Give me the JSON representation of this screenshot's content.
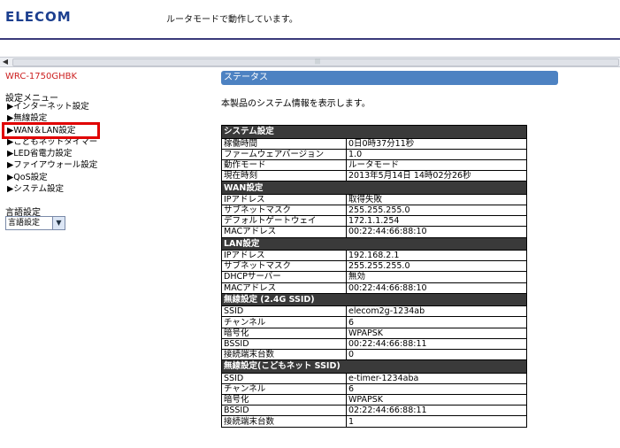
{
  "header": {
    "logo": "ELECOM",
    "mode_text": "ルータモードで動作しています。"
  },
  "sidebar": {
    "model": "WRC-1750GHBK",
    "menu_title": "設定メニュー",
    "items": [
      {
        "label": "▶インターネット設定"
      },
      {
        "label": "▶無線設定"
      },
      {
        "label": "▶WAN＆LAN設定"
      },
      {
        "label": "▶こどもネットタイマー"
      },
      {
        "label": "▶LED省電力設定"
      },
      {
        "label": "▶ファイアウォール設定"
      },
      {
        "label": "▶QoS設定"
      },
      {
        "label": "▶システム設定"
      }
    ],
    "active_index": 2,
    "lang_title": "言語設定",
    "lang_select": "言語設定"
  },
  "main": {
    "status_title": "ステータス",
    "description": "本製品のシステム情報を表示します。",
    "sections": [
      {
        "title": "システム設定",
        "rows": [
          [
            "稼働時間",
            "0日0時37分11秒"
          ],
          [
            "ファームウェアバージョン",
            "1.0"
          ],
          [
            "動作モード",
            "ルータモード"
          ],
          [
            "現在時刻",
            "2013年5月14日 14時02分26秒"
          ]
        ]
      },
      {
        "title": "WAN設定",
        "rows": [
          [
            "IPアドレス",
            "取得失敗"
          ],
          [
            "サブネットマスク",
            "255.255.255.0"
          ],
          [
            "デフォルトゲートウェイ",
            "172.1.1.254"
          ],
          [
            "MACアドレス",
            "00:22:44:66:88:10"
          ]
        ]
      },
      {
        "title": "LAN設定",
        "rows": [
          [
            "IPアドレス",
            "192.168.2.1"
          ],
          [
            "サブネットマスク",
            "255.255.255.0"
          ],
          [
            "DHCPサーバー",
            "無効"
          ],
          [
            "MACアドレス",
            "00:22:44:66:88:10"
          ]
        ]
      },
      {
        "title": "無線設定 (2.4G SSID)",
        "rows": [
          [
            "SSID",
            "elecom2g-1234ab"
          ],
          [
            "チャンネル",
            "6"
          ],
          [
            "暗号化",
            "WPAPSK"
          ],
          [
            "BSSID",
            "00:22:44:66:88:11"
          ],
          [
            "接続端末台数",
            "0"
          ]
        ]
      },
      {
        "title": "無線設定(こどもネット SSID)",
        "rows": [
          [
            "SSID",
            "e-timer-1234aba"
          ],
          [
            "チャンネル",
            "6"
          ],
          [
            "暗号化",
            "WPAPSK"
          ],
          [
            "BSSID",
            "02:22:44:66:88:11"
          ],
          [
            "接続端末台数",
            "1"
          ]
        ]
      }
    ]
  },
  "colors": {
    "logo": "#1c3f8f",
    "model": "#cc1f1f",
    "status_bar": "#4d82c2",
    "section_header": "#3a3a3a",
    "active_outline": "#e00000"
  }
}
